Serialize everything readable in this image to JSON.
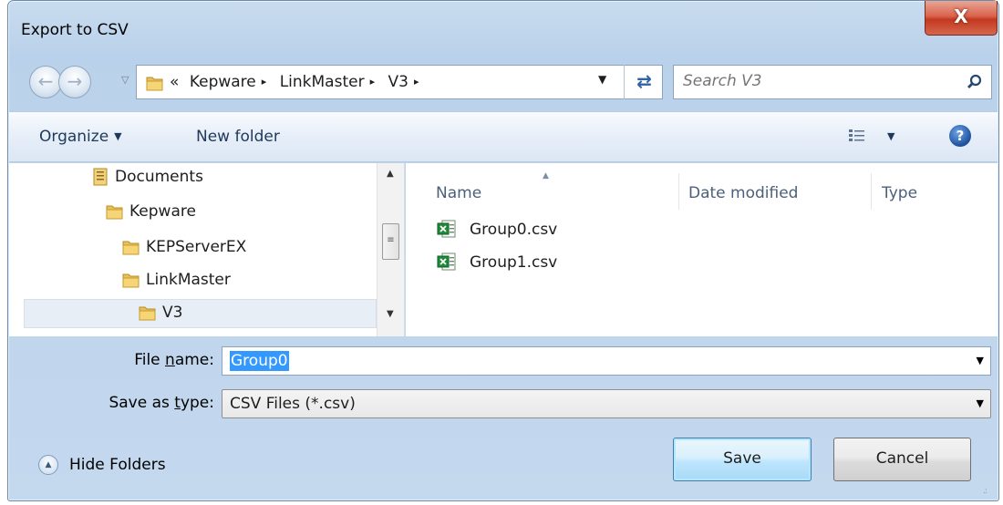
{
  "window": {
    "title": "Export to CSV",
    "close_glyph": "X"
  },
  "address_bar": {
    "overflow_glyph": "«",
    "breadcrumbs": [
      "Kepware",
      "LinkMaster",
      "V3"
    ],
    "separator_glyph": "▸"
  },
  "search": {
    "placeholder": "Search V3"
  },
  "toolbar": {
    "organize_label": "Organize",
    "new_folder_label": "New folder",
    "help_glyph": "?"
  },
  "tree": {
    "items": [
      {
        "label": "Documents",
        "icon": "documents-library-icon"
      },
      {
        "label": "Kepware",
        "icon": "folder-icon"
      },
      {
        "label": "KEPServerEX",
        "icon": "folder-icon"
      },
      {
        "label": "LinkMaster",
        "icon": "folder-icon"
      },
      {
        "label": "V3",
        "icon": "folder-icon",
        "selected": true
      }
    ]
  },
  "file_list": {
    "columns": [
      "Name",
      "Date modified",
      "Type"
    ],
    "files": [
      {
        "name": "Group0.csv",
        "icon": "excel-csv-icon"
      },
      {
        "name": "Group1.csv",
        "icon": "excel-csv-icon"
      }
    ]
  },
  "form": {
    "file_name_label_pre": "File ",
    "file_name_label_ul": "n",
    "file_name_label_post": "ame:",
    "file_name_value": "Group0",
    "save_type_label_pre": "Save as ",
    "save_type_label_ul": "t",
    "save_type_label_post": "ype:",
    "save_type_value": "CSV Files (*.csv)"
  },
  "footer": {
    "hide_folders_label": "Hide Folders",
    "save_label": "Save",
    "cancel_label": "Cancel"
  },
  "colors": {
    "title_bar_bg": "#bcd3eb",
    "close_button": "#c7412a",
    "selection_highlight": "#3399ff",
    "save_button_accent": "#3c7fb1"
  }
}
